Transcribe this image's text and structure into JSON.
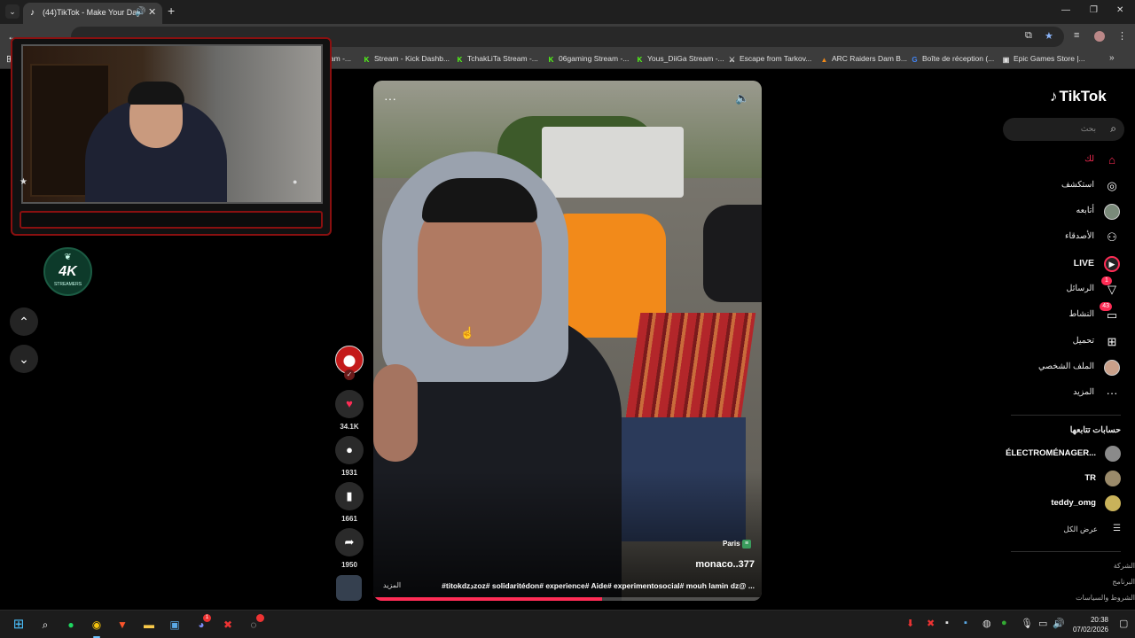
{
  "browser": {
    "tab": {
      "title": "(44)TikTok - Make Your Day",
      "favicon_icon": "tiktok-icon",
      "audio_icon": "speaker-icon"
    },
    "bookmarks": [
      {
        "label": "tream -...",
        "icon": "kick-icon",
        "color": "#53fc18"
      },
      {
        "label": "Stream - Kick Dashb...",
        "icon": "kick-icon",
        "color": "#53fc18"
      },
      {
        "label": "TchakLiTa Stream -...",
        "icon": "kick-icon",
        "color": "#53fc18"
      },
      {
        "label": "06gaming Stream -...",
        "icon": "kick-icon",
        "color": "#53fc18"
      },
      {
        "label": "Yous_DiiGa Stream -...",
        "icon": "kick-icon",
        "color": "#53fc18"
      },
      {
        "label": "Escape from Tarkov...",
        "icon": "tarkov-icon",
        "color": "#dddddd"
      },
      {
        "label": "ARC Raiders Dam B...",
        "icon": "arc-icon",
        "color": "#f08a1a"
      },
      {
        "label": "Boîte de réception (...",
        "icon": "google-icon",
        "color": "#4285f4"
      },
      {
        "label": "Epic Games Store |...",
        "icon": "epic-icon",
        "color": "#dddddd"
      }
    ]
  },
  "logo": {
    "main": "4K",
    "sub": "STREAMERS"
  },
  "video": {
    "author": "monaco..377",
    "location": "Paris",
    "caption": "#titokdzدzoz# solidaritédon# experience# Aide# experimentosocial# mouh lamin dz@ ...",
    "more_label": "المزيد",
    "progress": 0.59
  },
  "actions": {
    "likes": "34.1K",
    "comments": "1931",
    "saves": "1661",
    "shares": "1950"
  },
  "sidebar": {
    "brand": "TikTok",
    "search_placeholder": "بحث",
    "nav": [
      {
        "label": "لك",
        "icon": "home-icon",
        "active": true
      },
      {
        "label": "استكشف",
        "icon": "compass-icon"
      },
      {
        "label": "أتابعه",
        "icon": "avatar-icon"
      },
      {
        "label": "الأصدقاء",
        "icon": "friends-icon"
      },
      {
        "label": "LIVE",
        "icon": "live-icon"
      },
      {
        "label": "الرسائل",
        "icon": "messages-icon",
        "badge": "1"
      },
      {
        "label": "النشاط",
        "icon": "activity-icon",
        "badge": "43"
      },
      {
        "label": "تحميل",
        "icon": "upload-icon"
      },
      {
        "label": "الملف الشخصي",
        "icon": "profile-icon"
      },
      {
        "label": "المزيد",
        "icon": "more-icon"
      }
    ],
    "following_title": "حسابات تتابعها",
    "following": [
      {
        "name": "ÉLECTROMÉNAGER...",
        "color": "#8a8a8a"
      },
      {
        "name": "TR",
        "color": "#9a8a6a"
      },
      {
        "name": "teddy_omg",
        "color": "#c9b25a"
      }
    ],
    "see_all": "عرض الكل",
    "footer": [
      "الشركة",
      "البرنامج",
      "الشروط والسياسات"
    ]
  },
  "taskbar": {
    "time": "20:38",
    "date": "07/02/2026",
    "discord_badge": "1"
  }
}
